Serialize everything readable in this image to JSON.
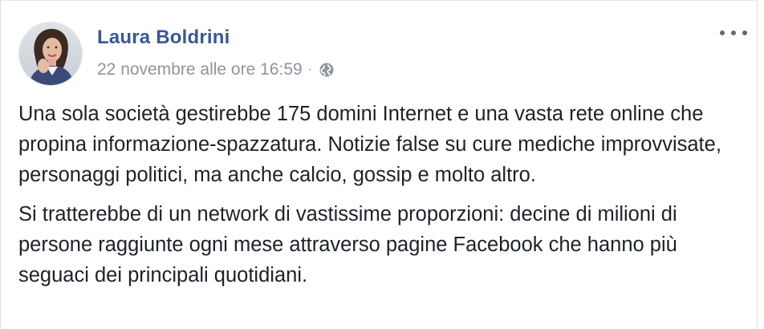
{
  "post": {
    "author": "Laura Boldrini",
    "timestamp": "22 novembre alle ore 16:59",
    "separator": "·",
    "privacy_icon": "globe-icon",
    "more_icon": "more-options-icon",
    "paragraphs": [
      "Una sola società gestirebbe 175 domini Internet e una vasta rete online che propina informazione-spazzatura. Notizie false su cure mediche improvvisate, personaggi politici, ma anche calcio, gossip e molto altro.",
      "Si tratterebbe di un network di vastissime proporzioni: decine di milioni di persone raggiunte ogni mese attraverso pagine Facebook che hanno più seguaci dei principali quotidiani."
    ]
  },
  "colors": {
    "author_link": "#365899",
    "meta_text": "#90949c",
    "body_text": "#1d2129",
    "more_dots": "#606770"
  }
}
